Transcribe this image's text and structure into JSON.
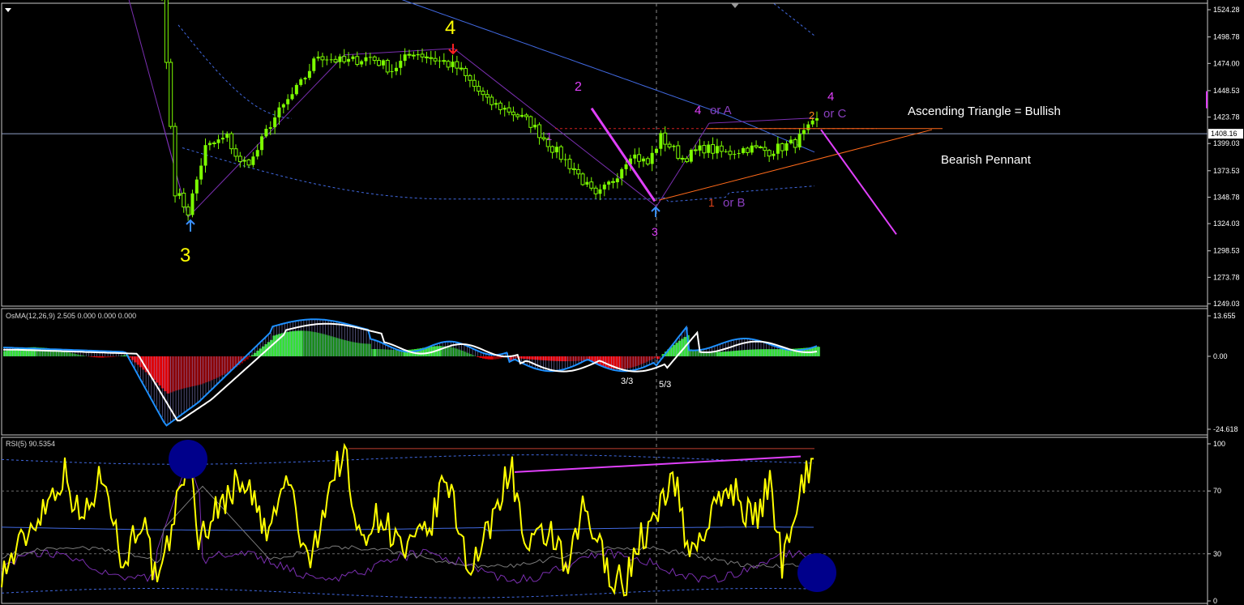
{
  "chart_data": [
    {
      "type": "candlestick",
      "panel": "price",
      "y_ticks": [
        "1524.28",
        "1498.78",
        "1474.00",
        "1448.53",
        "1423.78",
        "1399.03",
        "1373.53",
        "1348.78",
        "1324.03",
        "1298.53",
        "1273.78",
        "1249.03"
      ],
      "ylim": [
        1249.03,
        1524.28
      ],
      "current_price_label": "1408.16",
      "current_price": 1408.16,
      "waypoints": [
        [
          0,
          1535
        ],
        [
          3,
          1355
        ],
        [
          6,
          1335
        ],
        [
          10,
          1395
        ],
        [
          15,
          1405
        ],
        [
          18,
          1380
        ],
        [
          21,
          1385
        ],
        [
          25,
          1418
        ],
        [
          32,
          1455
        ],
        [
          36,
          1482
        ],
        [
          42,
          1475
        ],
        [
          48,
          1480
        ],
        [
          53,
          1468
        ],
        [
          58,
          1485
        ],
        [
          63,
          1478
        ],
        [
          68,
          1470
        ],
        [
          73,
          1448
        ],
        [
          75,
          1438
        ],
        [
          80,
          1430
        ],
        [
          85,
          1418
        ],
        [
          90,
          1395
        ],
        [
          95,
          1375
        ],
        [
          100,
          1348
        ],
        [
          104,
          1365
        ],
        [
          108,
          1390
        ],
        [
          112,
          1380
        ],
        [
          115,
          1405
        ],
        [
          120,
          1385
        ],
        [
          125,
          1395
        ],
        [
          130,
          1390
        ],
        [
          135,
          1395
        ],
        [
          140,
          1392
        ],
        [
          146,
          1400
        ],
        [
          151,
          1420
        ]
      ],
      "annotations": [
        {
          "text": "3",
          "color": "#ffff00"
        },
        {
          "text": "4",
          "color": "#ffff00"
        },
        {
          "text": "2",
          "color": "#e040fb"
        },
        {
          "text": "1",
          "color": "#c040e0"
        },
        {
          "text": "3",
          "color": "#e040fb"
        },
        {
          "text": "4",
          "color": "#e040fb"
        },
        {
          "text": "or A",
          "color": "#8a3fbf"
        },
        {
          "text": "1",
          "color": "#e0441a"
        },
        {
          "text": "or B",
          "color": "#8a3fbf"
        },
        {
          "text": "2",
          "color": "#ff8c1a"
        },
        {
          "text": "4",
          "color": "#e040fb"
        },
        {
          "text": "or C",
          "color": "#8a3fbf"
        },
        {
          "text": "Ascending Triangle = Bullish",
          "color": "#ffffff"
        },
        {
          "text": "Bearish Pennant",
          "color": "#ffffff"
        }
      ]
    },
    {
      "type": "histogram",
      "panel": "oscillator",
      "title": "OsMA(12,26,9) 2.505 0.000 0.000 0.000",
      "y_ticks": [
        "13.655",
        "0.00",
        "-24.618"
      ],
      "ylim": [
        -24.618,
        13.655
      ],
      "annotations": [
        {
          "text": "3/3",
          "color": "#ffffff"
        },
        {
          "text": "5/3",
          "color": "#ffffff"
        }
      ]
    },
    {
      "type": "line",
      "panel": "rsi",
      "title": "RSI(5) 90.5354",
      "y_ticks": [
        "100",
        "70",
        "30",
        "0"
      ],
      "ylim": [
        0,
        100
      ],
      "last_value": 90.5354
    }
  ],
  "colors": {
    "background": "#000000",
    "bull_candle": "#7cfc00",
    "ma_blue": "#4169e1",
    "rsi_line": "#ffff00",
    "magenta": "#e040fb",
    "orange": "#ff6a1a",
    "hist_green": "#22c022",
    "hist_red": "#e00000",
    "osma_cyan": "#1e90ff",
    "osma_white": "#ffffff",
    "circle": "#00008b"
  }
}
